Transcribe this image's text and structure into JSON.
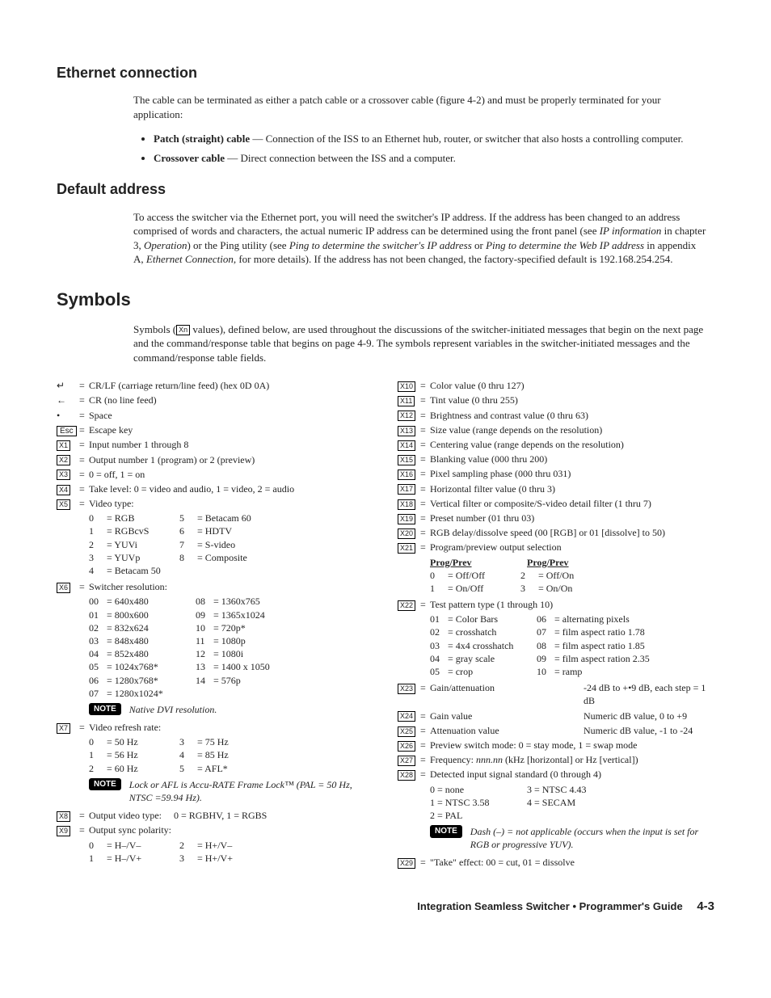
{
  "h_ethernet": "Ethernet connection",
  "p_ethernet": "The cable can be terminated as either a patch cable or a crossover cable (figure 4-2) and must be properly terminated for your application:",
  "bullet1_bold": "Patch (straight) cable",
  "bullet1_rest": " — Connection of the ISS to an Ethernet hub, router, or switcher that also hosts a controlling computer.",
  "bullet2_bold": "Crossover cable",
  "bullet2_rest": " — Direct connection between the ISS and a computer.",
  "h_default": "Default address",
  "p_default_1": "To access the switcher via the Ethernet port, you will need the switcher's IP address.  If the address has been changed to an address comprised of words and characters, the actual numeric IP address can be determined using the front panel (see ",
  "p_default_i1": "IP information",
  "p_default_2": " in chapter 3, ",
  "p_default_i2": "Operation",
  "p_default_3": ") or the Ping utility (see ",
  "p_default_i3": "Ping to determine the switcher's IP address",
  "p_default_4": " or ",
  "p_default_i4": "Ping to determine the Web IP address",
  "p_default_5": " in appendix A, ",
  "p_default_i5": "Ethernet Connection",
  "p_default_6": ", for more details).  If the address has not been changed, the factory-specified default is 192.168.254.254.",
  "h_symbols": "Symbols",
  "p_symbols_1": "Symbols (",
  "p_symbols_xn": "Xn",
  "p_symbols_2": " values), defined below, are used throughout the discussions of the switcher-initiated messages that begin on the next page and the command/response table that begins on page 4-9.  The symbols represent variables in the switcher-initiated messages and the command/response table fields.",
  "left": {
    "crlf_sym": "↵",
    "crlf": "CR/LF (carriage return/line feed) (hex 0D 0A)",
    "cr_sym": "←",
    "cr": "CR (no line feed)",
    "space_sym": "•",
    "space": "Space",
    "esc_sym": "Esc",
    "esc": "Escape key",
    "x1_sym": "X1",
    "x1": "Input number 1 through 8",
    "x2_sym": "X2",
    "x2": "Output number 1 (program) or 2 (preview)",
    "x3_sym": "X3",
    "x3": "0 = off, 1 = on",
    "x4_sym": "X4",
    "x4": "Take level: 0 = video and audio, 1 = video, 2 = audio",
    "x5_sym": "X5",
    "x5": "Video type:",
    "vt": [
      [
        "0",
        "= RGB",
        "5",
        "= Betacam 60"
      ],
      [
        "1",
        "= RGBcvS",
        "6",
        "= HDTV"
      ],
      [
        "2",
        "= YUVi",
        "7",
        "= S-video"
      ],
      [
        "3",
        "= YUVp",
        "8",
        "= Composite"
      ],
      [
        "4",
        "= Betacam 50",
        "",
        ""
      ]
    ],
    "x6_sym": "X6",
    "x6": "Switcher resolution:",
    "sr": [
      [
        "00",
        "= 640x480",
        "08",
        "= 1360x765"
      ],
      [
        "01",
        "= 800x600",
        "09",
        "= 1365x1024"
      ],
      [
        "02",
        "= 832x624",
        "10",
        "= 720p*"
      ],
      [
        "03",
        "= 848x480",
        "11",
        "= 1080p"
      ],
      [
        "04",
        "= 852x480",
        "12",
        "= 1080i"
      ],
      [
        "05",
        "= 1024x768*",
        "13",
        "= 1400 x 1050"
      ],
      [
        "06",
        "= 1280x768*",
        "14",
        "= 576p"
      ],
      [
        "07",
        "= 1280x1024*",
        "",
        ""
      ]
    ],
    "note1_label": "NOTE",
    "note1": "Native DVI resolution.",
    "x7_sym": "X7",
    "x7": "Video refresh rate:",
    "vr": [
      [
        "0",
        "= 50 Hz",
        "3",
        "= 75 Hz"
      ],
      [
        "1",
        "= 56 Hz",
        "4",
        "= 85 Hz"
      ],
      [
        "2",
        "= 60 Hz",
        "5",
        "= AFL*"
      ]
    ],
    "note2_label": "NOTE",
    "note2": "Lock or AFL is Accu-RATE Frame Lock™ (PAL = 50 Hz, NTSC =59.94 Hz).",
    "x8_sym": "X8",
    "x8_a": "Output video type:",
    "x8_b": "0 = RGBHV, 1 = RGBS",
    "x9_sym": "X9",
    "x9": "Output sync polarity:",
    "sp": [
      [
        "0",
        "= H–/V–",
        "2",
        "= H+/V–"
      ],
      [
        "1",
        "= H–/V+",
        "3",
        "= H+/V+"
      ]
    ]
  },
  "right": {
    "x10_sym": "X10",
    "x10": "Color value (0 thru 127)",
    "x11_sym": "X11",
    "x11": "Tint value (0 thru 255)",
    "x12_sym": "X12",
    "x12": "Brightness and contrast value (0 thru 63)",
    "x13_sym": "X13",
    "x13": "Size value (range depends on the resolution)",
    "x14_sym": "X14",
    "x14": "Centering value (range depends on the resolution)",
    "x15_sym": "X15",
    "x15": "Blanking value (000 thru 200)",
    "x16_sym": "X16",
    "x16": "Pixel sampling phase (000 thru 031)",
    "x17_sym": "X17",
    "x17": "Horizontal filter value (0 thru 3)",
    "x18_sym": "X18",
    "x18": "Vertical filter or composite/S-video detail filter (1 thru 7)",
    "x19_sym": "X19",
    "x19": "Preset number (01 thru 03)",
    "x20_sym": "X20",
    "x20": "RGB delay/dissolve speed (00 [RGB] or 01 [dissolve] to 50)",
    "x21_sym": "X21",
    "x21": "Program/preview output selection",
    "pp_head1": "Prog/Prev",
    "pp_head2": "Prog/Prev",
    "pp": [
      [
        "0",
        "= Off/Off",
        "2",
        "= Off/On"
      ],
      [
        "1",
        "= On/Off",
        "3",
        "= On/On"
      ]
    ],
    "x22_sym": "X22",
    "x22": "Test pattern type (1 through 10)",
    "tp": [
      [
        "01",
        "= Color Bars",
        "06",
        "= alternating pixels"
      ],
      [
        "02",
        "= crosshatch",
        "07",
        "= film aspect ratio 1.78"
      ],
      [
        "03",
        "= 4x4 crosshatch",
        "08",
        "= film aspect ratio 1.85"
      ],
      [
        "04",
        "= gray scale",
        "09",
        "= film aspect ration 2.35"
      ],
      [
        "05",
        "= crop",
        "10",
        "= ramp"
      ]
    ],
    "x23_sym": "X23",
    "x23_a": "Gain/attenuation",
    "x23_b": "-24 dB to +•9 dB, each step = 1 dB",
    "x24_sym": "X24",
    "x24_a": "Gain value",
    "x24_b": "Numeric dB value, 0 to +9",
    "x25_sym": "X25",
    "x25_a": "Attenuation value",
    "x25_b": "Numeric dB value, -1 to -24",
    "x26_sym": "X26",
    "x26": "Preview switch mode: 0 = stay mode, 1 = swap mode",
    "x27_sym": "X27",
    "x27_a": "Frequency: ",
    "x27_i": "nnn.nn",
    "x27_b": " (kHz [horizontal] or Hz [vertical])",
    "x28_sym": "X28",
    "x28": "Detected input signal standard (0 through 4)",
    "sig": [
      [
        "0 = none",
        "3 = NTSC 4.43"
      ],
      [
        "1 = NTSC 3.58",
        "4 = SECAM"
      ],
      [
        "2 = PAL",
        ""
      ]
    ],
    "note3_label": "NOTE",
    "note3": "Dash (–) = not applicable (occurs when the input is set for RGB or progressive YUV).",
    "x29_sym": "X29",
    "x29": "\"Take\" effect: 00 = cut, 01 = dissolve"
  },
  "footer_title": "Integration Seamless Switcher • Programmer's Guide",
  "footer_page": "4-3"
}
